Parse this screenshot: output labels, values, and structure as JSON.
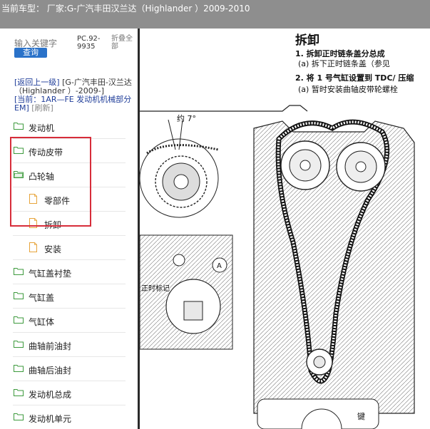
{
  "titlebar": {
    "text": "当前车型：  厂家:G-广汽丰田汉兰达（Highlander ）2009-2010"
  },
  "search": {
    "label": "输入关键字",
    "button": "查询"
  },
  "pc_code": "PC.92-9935",
  "collapse_all": "折叠全部",
  "breadcrumb": {
    "back": "[返回上一级]",
    "model": "[G-广汽丰田-汉兰达（Highlander ）-2009-]",
    "current": "[当前：1AR—FE 发动机机械部分 EM]",
    "refresh": "[刷新]"
  },
  "tree": [
    {
      "label": "发动机",
      "type": "folder"
    },
    {
      "label": "传动皮带",
      "type": "folder"
    },
    {
      "label": "凸轮轴",
      "type": "folder-open"
    },
    {
      "label": "零部件",
      "type": "doc"
    },
    {
      "label": "拆卸",
      "type": "doc"
    },
    {
      "label": "安装",
      "type": "doc"
    },
    {
      "label": "气缸盖衬垫",
      "type": "folder"
    },
    {
      "label": "气缸盖",
      "type": "folder"
    },
    {
      "label": "气缸体",
      "type": "folder"
    },
    {
      "label": "曲轴前油封",
      "type": "folder"
    },
    {
      "label": "曲轴后油封",
      "type": "folder"
    },
    {
      "label": "发动机总成",
      "type": "folder"
    },
    {
      "label": "发动机单元",
      "type": "folder"
    }
  ],
  "manual": {
    "title": "拆卸",
    "step1": "1.   拆卸正时链条盖分总成",
    "step1a": "(a)   拆下正时链条盖（参见",
    "step2": "2.   将 1 号气缸设置到 TDC/ 压缩",
    "step2a": "(a)   暂时安装曲轴皮带轮螺栓",
    "angle": "约 7°",
    "timing_mark": "正时标记",
    "mark_a": "A",
    "key": "键"
  },
  "colors": {
    "titlebar": "#8e8e8e",
    "button": "#2a72c9",
    "highlight": "#d72d3a",
    "link": "#1f3d99"
  }
}
